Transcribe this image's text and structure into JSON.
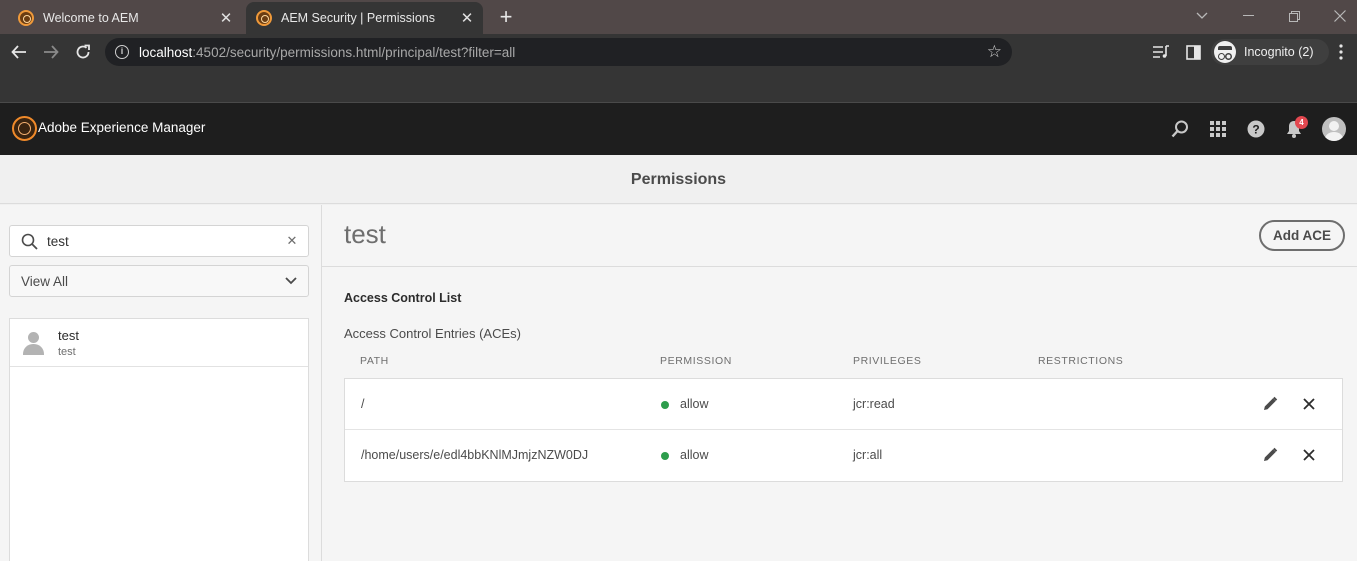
{
  "browser": {
    "tabs": [
      {
        "title": "Welcome to AEM",
        "active": false
      },
      {
        "title": "AEM Security | Permissions",
        "active": true
      }
    ],
    "url_host": "localhost",
    "url_rest": ":4502/security/permissions.html/principal/test?filter=all",
    "profile_label": "Incognito (2)"
  },
  "shell": {
    "product_name": "Adobe Experience Manager",
    "notification_count": "4"
  },
  "page": {
    "title": "Permissions"
  },
  "rail": {
    "search_value": "test",
    "filter_selected": "View All",
    "users": [
      {
        "name": "test",
        "id": "test"
      }
    ]
  },
  "main": {
    "principal_name": "test",
    "add_ace_label": "Add ACE",
    "acl_heading": "Access Control List",
    "ace_heading": "Access Control Entries (ACEs)",
    "columns": {
      "path": "PATH",
      "permission": "PERMISSION",
      "privileges": "PRIVILEGES",
      "restrictions": "RESTRICTIONS"
    },
    "entries": [
      {
        "path": "/",
        "permission": "allow",
        "privileges": "jcr:read",
        "restrictions": ""
      },
      {
        "path": "/home/users/e/edl4bbKNlMJmjzNZW0DJ",
        "permission": "allow",
        "privileges": "jcr:all",
        "restrictions": ""
      }
    ]
  },
  "colors": {
    "allow_status": "#2d9d4c",
    "aem_brand": "#f08a2a",
    "notification_badge": "#e34850"
  }
}
